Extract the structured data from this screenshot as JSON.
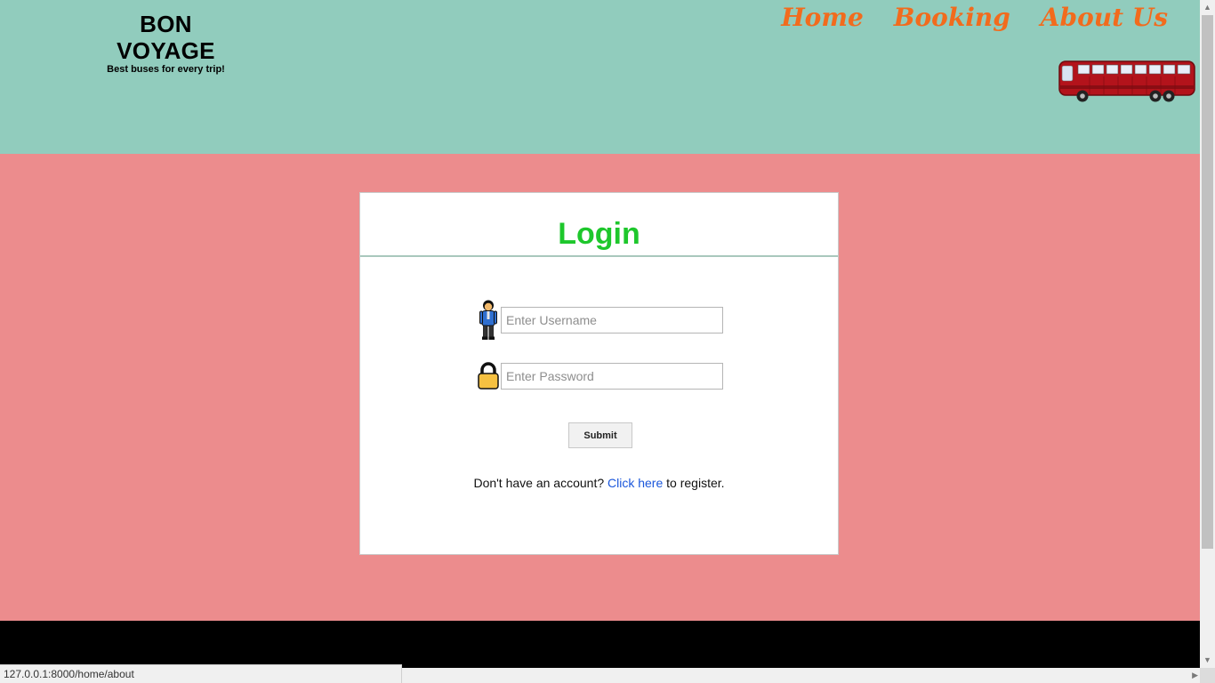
{
  "brand": {
    "title": "BON VOYAGE",
    "tagline": "Best buses for every trip!"
  },
  "nav": [
    {
      "label": "Home"
    },
    {
      "label": "Booking"
    },
    {
      "label": "About Us"
    }
  ],
  "login": {
    "title": "Login",
    "username_placeholder": "Enter Username",
    "password_placeholder": "Enter Password",
    "submit_label": "Submit",
    "register_prefix": "Don't have an account? ",
    "register_link": "Click here",
    "register_suffix": " to register."
  },
  "status_bar": {
    "url": "127.0.0.1:8000/home/about"
  },
  "colors": {
    "header": "#91ccbd",
    "main": "#ec8c8d",
    "nav_text": "#f26b1d",
    "login_title": "#1ec72c",
    "link": "#1a56db",
    "footer": "#000000"
  },
  "icons": {
    "user": "person-icon",
    "password": "lock-icon",
    "bus": "bus-icon"
  }
}
